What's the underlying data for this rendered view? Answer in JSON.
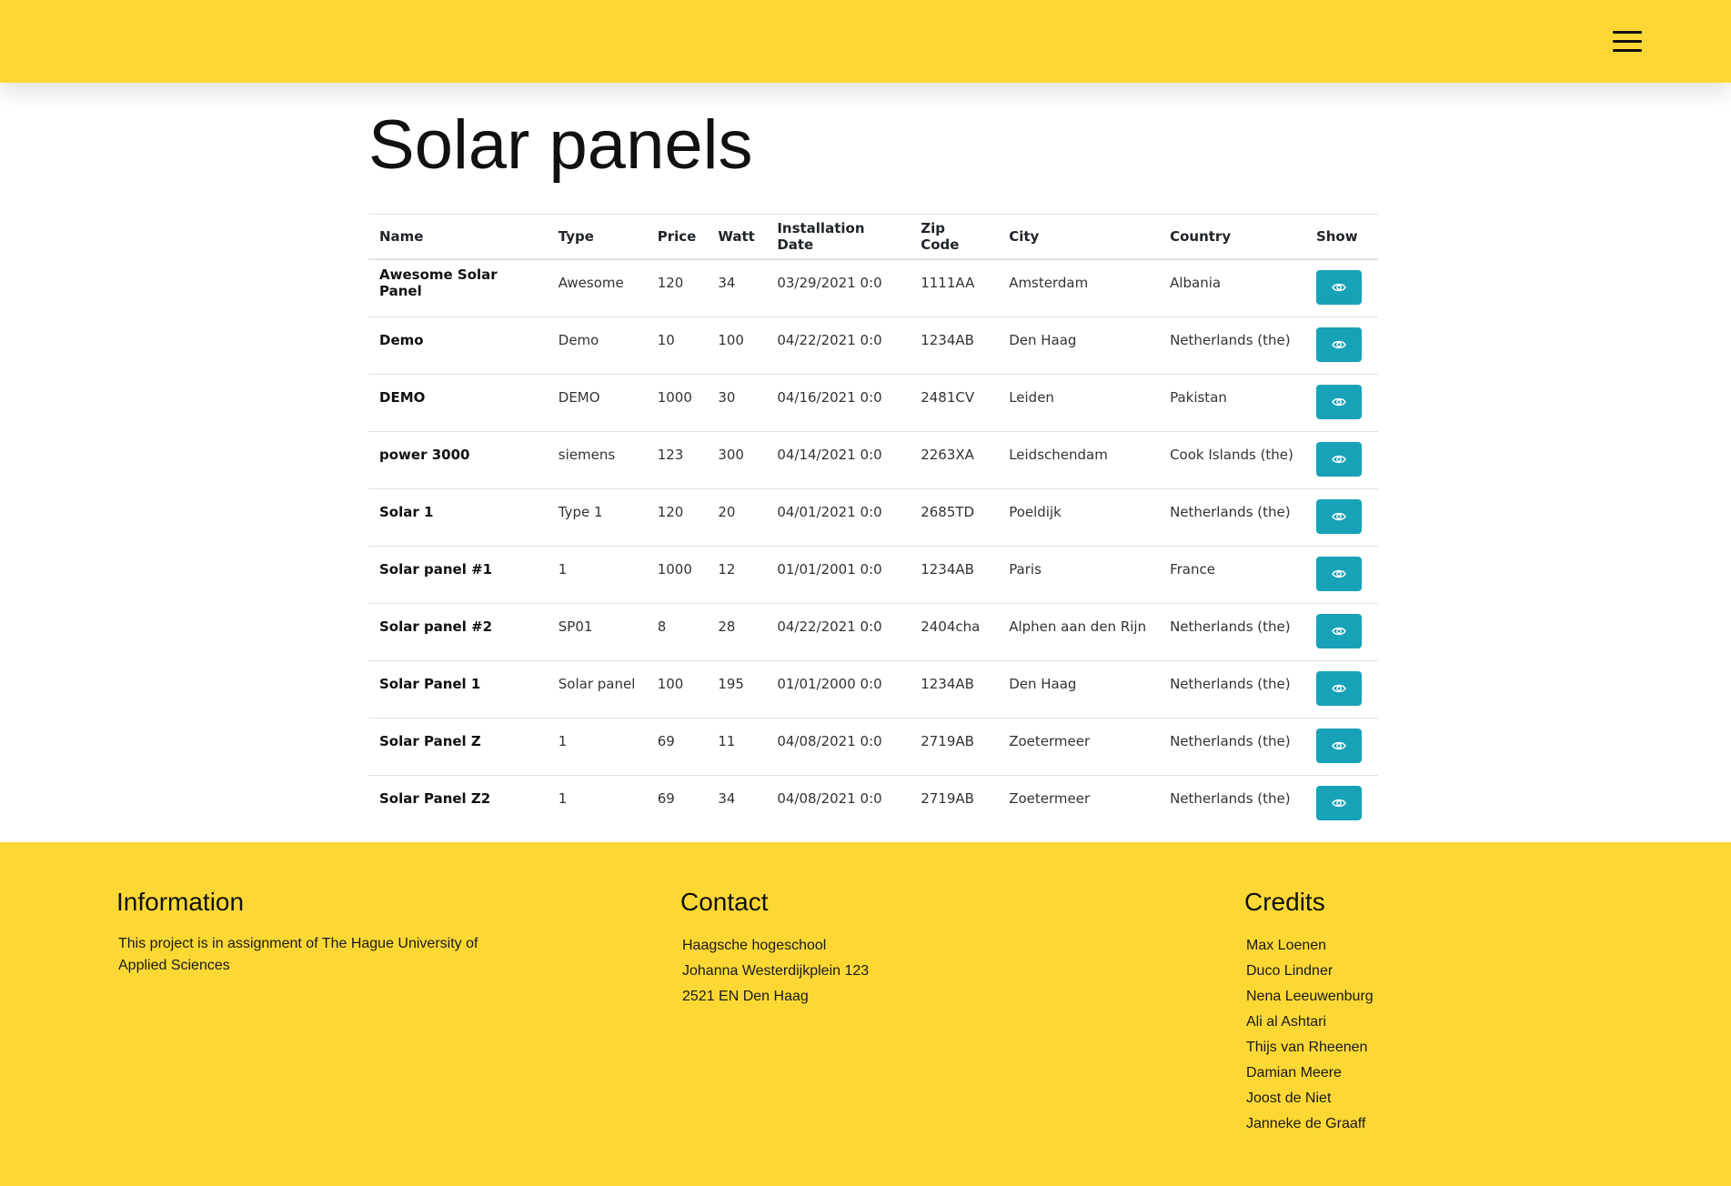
{
  "header": {
    "menu_icon": "hamburger-menu-icon",
    "background": "#fdd835"
  },
  "page": {
    "title": "Solar panels"
  },
  "table": {
    "headers": [
      "Name",
      "Type",
      "Price",
      "Watt",
      "Installation Date",
      "Zip Code",
      "City",
      "Country",
      "Show"
    ],
    "rows": [
      {
        "name": "Awesome Solar Panel",
        "type": "Awesome",
        "price": "120",
        "watt": "34",
        "date": "03/29/2021 0:0",
        "zip": "1111AA",
        "city": "Amsterdam",
        "country": "Albania"
      },
      {
        "name": "Demo",
        "type": "Demo",
        "price": "10",
        "watt": "100",
        "date": "04/22/2021 0:0",
        "zip": "1234AB",
        "city": "Den Haag",
        "country": "Netherlands (the)"
      },
      {
        "name": "DEMO",
        "type": "DEMO",
        "price": "1000",
        "watt": "30",
        "date": "04/16/2021 0:0",
        "zip": "2481CV",
        "city": "Leiden",
        "country": "Pakistan"
      },
      {
        "name": "power 3000",
        "type": "siemens",
        "price": "123",
        "watt": "300",
        "date": "04/14/2021 0:0",
        "zip": "2263XA",
        "city": "Leidschendam",
        "country": "Cook Islands (the)"
      },
      {
        "name": "Solar 1",
        "type": "Type 1",
        "price": "120",
        "watt": "20",
        "date": "04/01/2021 0:0",
        "zip": "2685TD",
        "city": "Poeldijk",
        "country": "Netherlands (the)"
      },
      {
        "name": "Solar panel #1",
        "type": "1",
        "price": "1000",
        "watt": "12",
        "date": "01/01/2001 0:0",
        "zip": "1234AB",
        "city": "Paris",
        "country": "France"
      },
      {
        "name": "Solar panel #2",
        "type": "SP01",
        "price": "8",
        "watt": "28",
        "date": "04/22/2021 0:0",
        "zip": "2404cha",
        "city": "Alphen aan den Rijn",
        "country": "Netherlands (the)"
      },
      {
        "name": "Solar Panel 1",
        "type": "Solar panel",
        "price": "100",
        "watt": "195",
        "date": "01/01/2000 0:0",
        "zip": "1234AB",
        "city": "Den Haag",
        "country": "Netherlands (the)"
      },
      {
        "name": "Solar Panel Z",
        "type": "1",
        "price": "69",
        "watt": "11",
        "date": "04/08/2021 0:0",
        "zip": "2719AB",
        "city": "Zoetermeer",
        "country": "Netherlands (the)"
      },
      {
        "name": "Solar Panel Z2",
        "type": "1",
        "price": "69",
        "watt": "34",
        "date": "04/08/2021 0:0",
        "zip": "2719AB",
        "city": "Zoetermeer",
        "country": "Netherlands (the)"
      }
    ],
    "show_button_icon": "eye-icon",
    "button_color": "#17a2b8"
  },
  "footer": {
    "information": {
      "heading": "Information",
      "text": "This project is in assignment of The Hague University of Applied Sciences"
    },
    "contact": {
      "heading": "Contact",
      "lines": [
        "Haagsche hogeschool",
        "Johanna Westerdijkplein 123",
        "2521 EN Den Haag"
      ]
    },
    "credits": {
      "heading": "Credits",
      "names": [
        "Max Loenen",
        "Duco Lindner",
        "Nena Leeuwenburg",
        "Ali al Ashtari",
        "Thijs van Rheenen",
        "Damian Meere",
        "Joost de Niet",
        "Janneke de Graaff"
      ]
    }
  }
}
